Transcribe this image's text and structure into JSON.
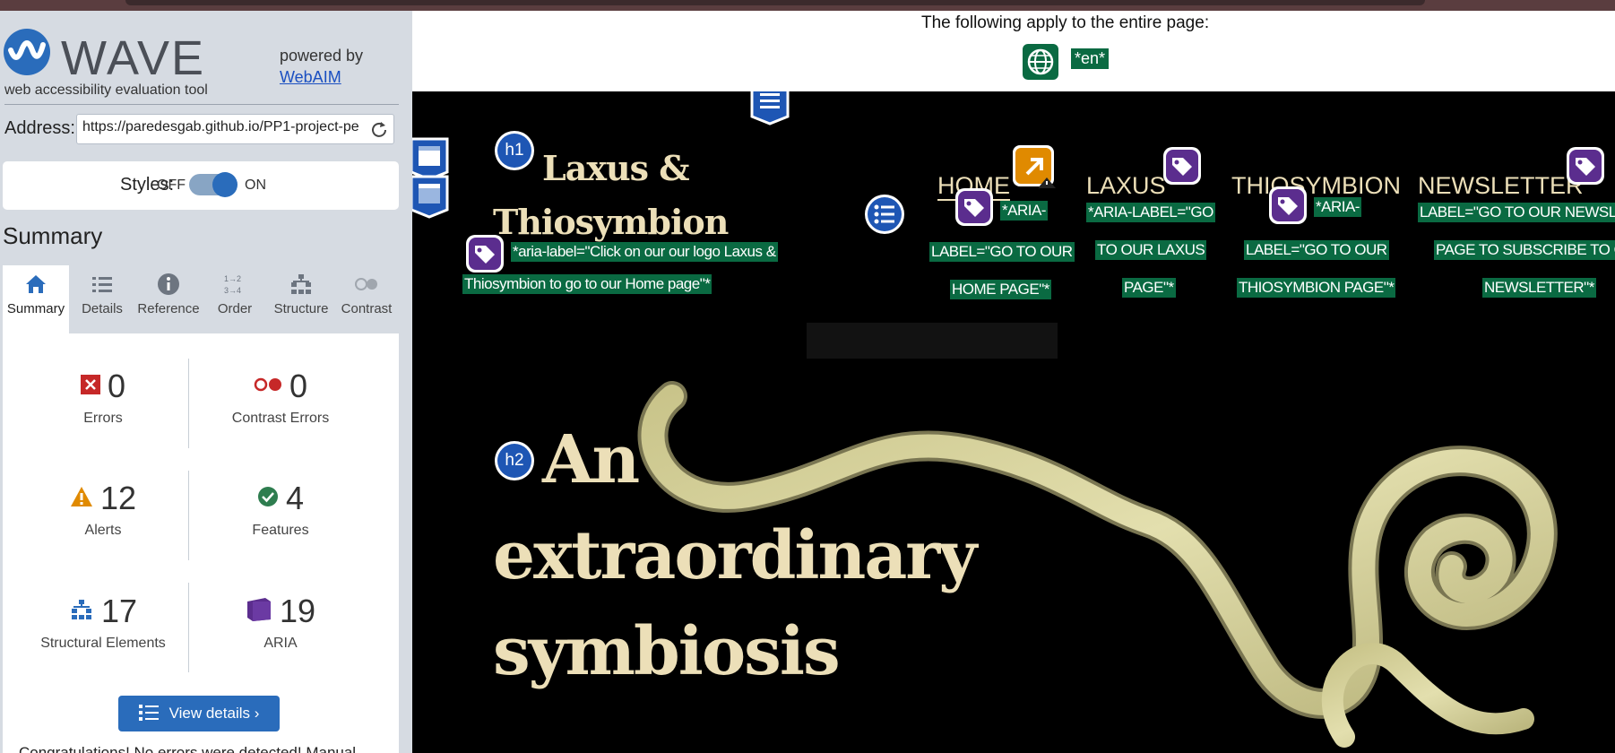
{
  "wave": {
    "logo_text": "WAVE",
    "tagline": "web accessibility evaluation tool",
    "powered_by": "powered by",
    "webaim_link": "WebAIM",
    "address_label": "Address:",
    "address_value": "https://paredesgab.github.io/PP1-project-pe",
    "styles_label": "Styles:",
    "styles_off": "OFF",
    "styles_on": "ON",
    "summary_heading": "Summary",
    "tabs": [
      {
        "label": "Summary",
        "icon": "home-icon"
      },
      {
        "label": "Details",
        "icon": "list-icon"
      },
      {
        "label": "Reference",
        "icon": "info-icon"
      },
      {
        "label": "Order",
        "icon": "order-icon"
      },
      {
        "label": "Structure",
        "icon": "structure-icon"
      },
      {
        "label": "Contrast",
        "icon": "contrast-icon"
      }
    ],
    "stats": {
      "errors": {
        "value": "0",
        "label": "Errors"
      },
      "contrast": {
        "value": "0",
        "label": "Contrast Errors"
      },
      "alerts": {
        "value": "12",
        "label": "Alerts"
      },
      "features": {
        "value": "4",
        "label": "Features"
      },
      "structural": {
        "value": "17",
        "label": "Structural Elements"
      },
      "aria": {
        "value": "19",
        "label": "ARIA"
      }
    },
    "view_details": "View details ›",
    "congrats": "Congratulations! No errors were detected! Manual"
  },
  "preview": {
    "apply_text": "The following apply to the entire page:",
    "lang_tag": "*en*",
    "brand_line1": "Laxus &",
    "brand_line2": "Thiosymbion",
    "logo_aria_1": "*aria-label=\"Click on our our logo Laxus &",
    "logo_aria_2": "Thiosymbion to go to our Home page\"*",
    "nav_home": "HOME",
    "nav_laxus": "LAXUS",
    "nav_thio": "THIOSYMBION",
    "nav_news": "NEWSLETTER",
    "home_aria": [
      "*ARIA-",
      "LABEL=\"GO TO OUR",
      "HOME PAGE\"*"
    ],
    "laxus_aria": [
      "*ARIA-LABEL=\"GO",
      "TO OUR LAXUS",
      "PAGE\"*"
    ],
    "thio_aria": [
      "*ARIA-",
      "LABEL=\"GO TO OUR",
      "THIOSYMBION PAGE\"*"
    ],
    "news_aria": [
      "LABEL=\"GO TO OUR NEWSLE",
      "PAGE TO SUBSCRIBE TO O",
      "NEWSLETTER\"*"
    ],
    "h1": "h1",
    "h2": "h2",
    "hero_1": "An",
    "hero_2": "extraordinary",
    "hero_3": "symbiosis"
  },
  "colors": {
    "wave_blue": "#2a6cbb",
    "aria_purple": "#5b2d8e",
    "feature_green": "#0a6a42",
    "alert_orange": "#e08a00",
    "error_red": "#c62828",
    "page_bg": "#000000",
    "text_cream": "#ecdfb8"
  }
}
